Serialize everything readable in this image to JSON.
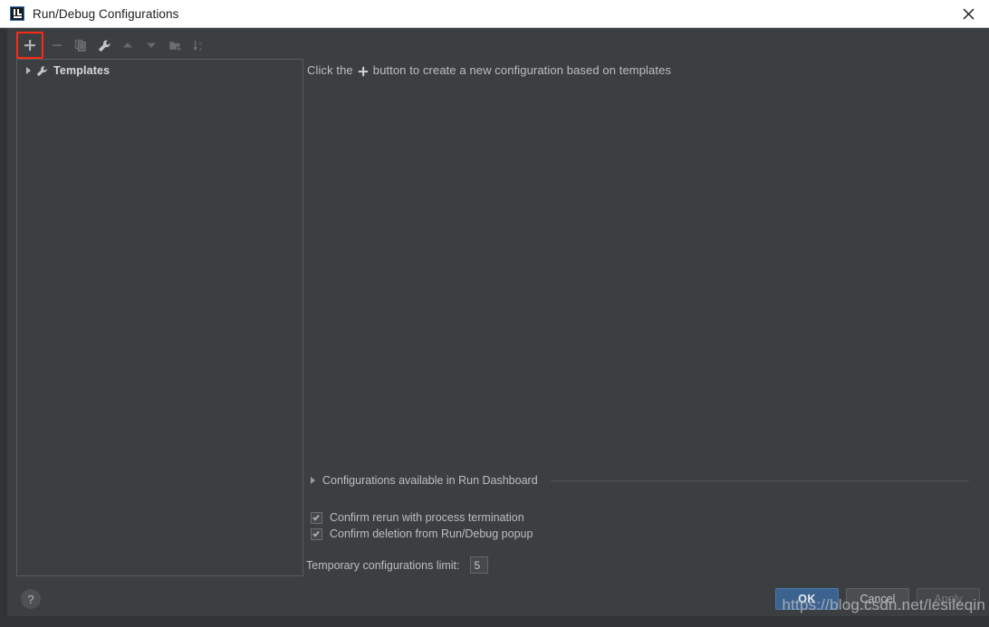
{
  "window": {
    "title": "Run/Debug Configurations",
    "app_icon": "intellij-idea-logo-icon",
    "close_icon": "close-icon"
  },
  "toolbar": {
    "buttons": [
      {
        "name": "add-configuration",
        "icon": "plus-icon",
        "label": "+",
        "enabled": true,
        "highlighted": true
      },
      {
        "name": "remove-configuration",
        "icon": "minus-icon",
        "label": "−",
        "enabled": false,
        "highlighted": false
      },
      {
        "name": "copy-configuration",
        "icon": "copy-icon",
        "label": "",
        "enabled": false,
        "highlighted": false
      },
      {
        "name": "edit-templates",
        "icon": "wrench-icon",
        "label": "",
        "enabled": true,
        "highlighted": false
      },
      {
        "name": "move-up",
        "icon": "arrow-up-icon",
        "label": "",
        "enabled": false,
        "highlighted": false
      },
      {
        "name": "move-down",
        "icon": "arrow-down-icon",
        "label": "",
        "enabled": false,
        "highlighted": false
      },
      {
        "name": "create-folder",
        "icon": "folder-add-icon",
        "label": "",
        "enabled": false,
        "highlighted": false
      },
      {
        "name": "sort-configurations",
        "icon": "sort-az-icon",
        "label": "",
        "enabled": false,
        "highlighted": false
      }
    ],
    "highlight_color": "#fc2a14"
  },
  "tree": {
    "items": [
      {
        "label": "Templates",
        "icon": "wrench-icon",
        "expander": "chevron-right-icon",
        "expanded": false
      }
    ]
  },
  "main": {
    "hint_prefix": "Click the",
    "hint_icon": "plus-icon",
    "hint_suffix": "button to create a new configuration based on templates",
    "run_dashboard": {
      "label": "Configurations available in Run Dashboard",
      "expander": "chevron-right-icon",
      "expanded": false
    },
    "checkboxes": [
      {
        "label": "Confirm rerun with process termination",
        "checked": true
      },
      {
        "label": "Confirm deletion from Run/Debug popup",
        "checked": true
      }
    ],
    "temp_limit": {
      "label": "Temporary configurations limit:",
      "value": "5"
    }
  },
  "footer": {
    "help_label": "?",
    "help_icon": "question-mark-icon",
    "buttons": [
      {
        "label": "OK",
        "style": "primary",
        "enabled": true
      },
      {
        "label": "Cancel",
        "style": "secondary",
        "enabled": true
      },
      {
        "label": "Apply",
        "style": "disabled",
        "enabled": false
      }
    ]
  },
  "watermark": {
    "text": "https://blog.csdn.net/lesileqin"
  },
  "colors": {
    "dialog_bg": "#3c3f41",
    "titlebar_bg": "#ffffff",
    "text_primary": "#bdbdbd",
    "accent_button": "#3c628f",
    "highlight": "#fc2a14"
  }
}
